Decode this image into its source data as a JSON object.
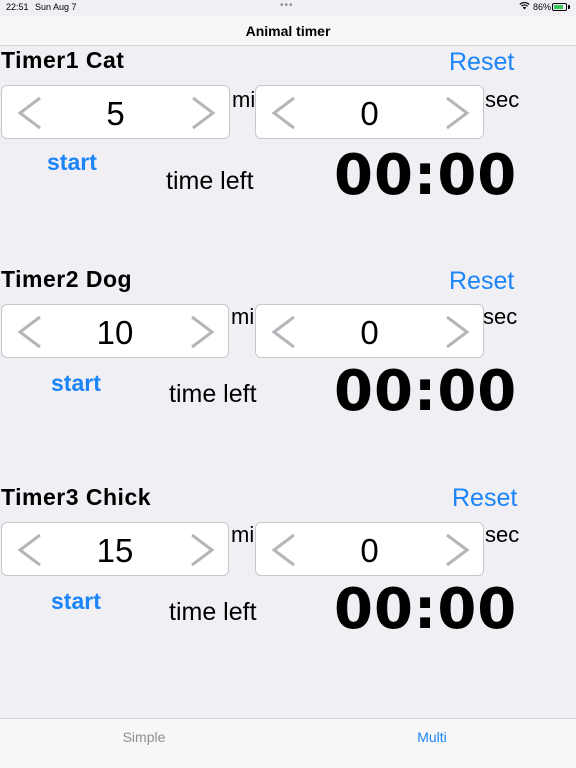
{
  "status_bar": {
    "time": "22:51",
    "date": "Sun Aug 7",
    "battery_percent": "86%",
    "battery_level": 0.86
  },
  "nav": {
    "title": "Animal timer"
  },
  "colors": {
    "accent": "#1b84f8",
    "chevron": "#b5b5ba",
    "background": "#efeff4",
    "battery": "#34c759"
  },
  "timers": [
    {
      "title": "Timer1 Cat",
      "reset_label": "Reset",
      "minutes": "5",
      "min_label": "min",
      "seconds": "0",
      "sec_label": "sec",
      "start_label": "start",
      "time_left_label": "time left",
      "countdown": "00:00"
    },
    {
      "title": "Timer2 Dog",
      "reset_label": "Reset",
      "minutes": "10",
      "min_label": "min",
      "seconds": "0",
      "sec_label": "sec",
      "start_label": "start",
      "time_left_label": "time left",
      "countdown": "00:00"
    },
    {
      "title": "Timer3 Chick",
      "reset_label": "Reset",
      "minutes": "15",
      "min_label": "min",
      "seconds": "0",
      "sec_label": "sec",
      "start_label": "start",
      "time_left_label": "time left",
      "countdown": "00:00"
    }
  ],
  "tabs": [
    {
      "label": "Simple",
      "active": false
    },
    {
      "label": "Multi",
      "active": true
    }
  ]
}
